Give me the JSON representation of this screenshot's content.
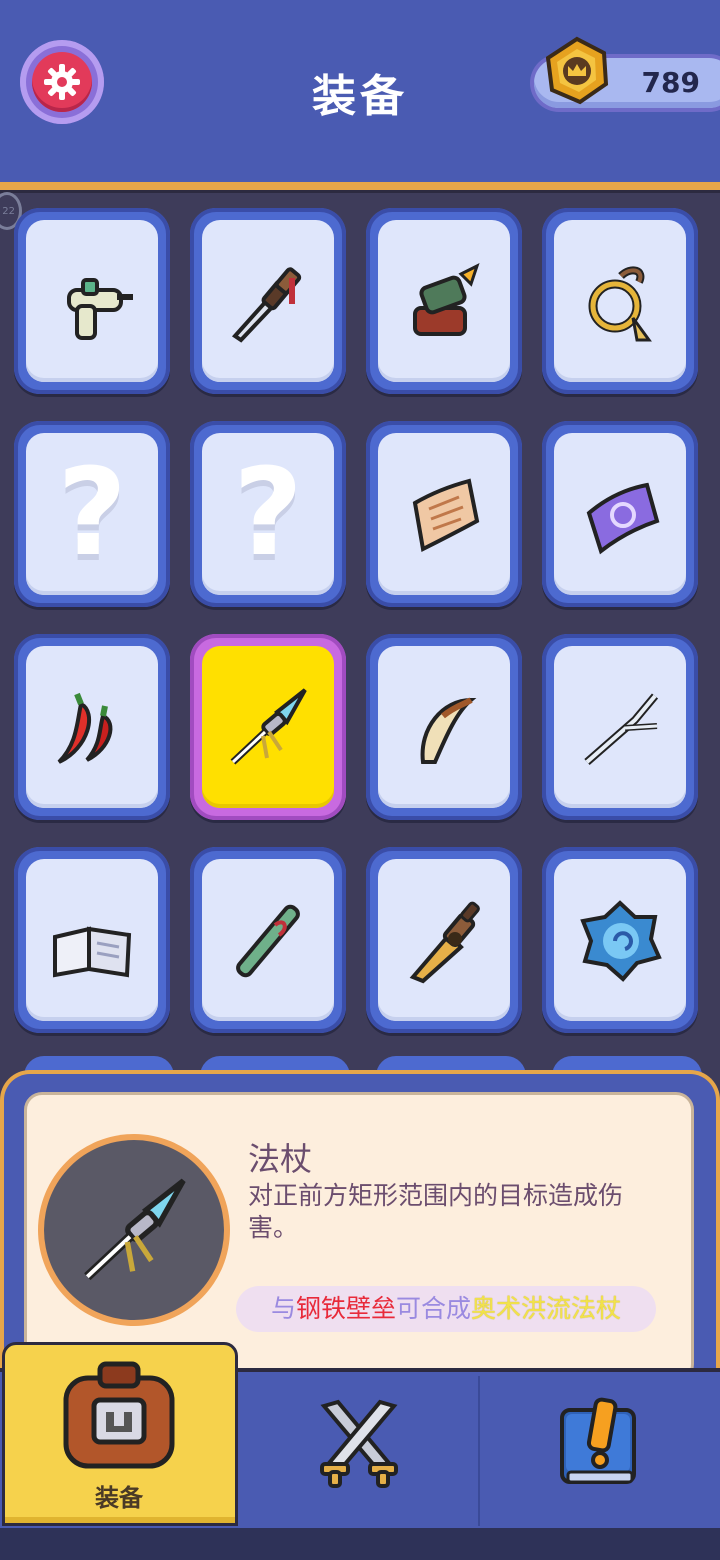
{
  "header": {
    "title": "装备",
    "coins": "789",
    "settings_icon": "gear-icon",
    "coin_icon": "crown-coin-icon",
    "side_badge": "22"
  },
  "grid": {
    "items": [
      {
        "icon": "water-gun-icon"
      },
      {
        "icon": "dagger-icon"
      },
      {
        "icon": "cannon-icon"
      },
      {
        "icon": "whip-icon"
      },
      {
        "icon": "question-mark",
        "label": "?"
      },
      {
        "icon": "question-mark",
        "label": "?"
      },
      {
        "icon": "ancient-scroll-icon"
      },
      {
        "icon": "magic-scroll-icon"
      },
      {
        "icon": "chili-pepper-icon"
      },
      {
        "icon": "spear-staff-icon",
        "selected": true
      },
      {
        "icon": "claw-icon"
      },
      {
        "icon": "branch-icon"
      },
      {
        "icon": "book-icon"
      },
      {
        "icon": "bamboo-flute-icon"
      },
      {
        "icon": "bronze-sword-icon"
      },
      {
        "icon": "blue-orb-icon"
      }
    ]
  },
  "info": {
    "name": "法杖",
    "description": "对正前方矩形范围内的目标造成伤害。",
    "combine": {
      "prefix": "与",
      "item": "钢铁壁垒",
      "middle": "可合成",
      "result": "奥术洪流法杖"
    },
    "icon": "spear-staff-icon"
  },
  "nav": {
    "tabs": [
      {
        "label": "装备",
        "icon": "backpack-icon",
        "active": true
      },
      {
        "label": "",
        "icon": "crossed-swords-icon"
      },
      {
        "label": "",
        "icon": "quest-book-icon"
      }
    ]
  },
  "colors": {
    "header_bg": "#4a5bb2",
    "accent_orange": "#e6a64a",
    "selected_slot": "#ffe000",
    "slot_bg": "#dfe6fb"
  }
}
